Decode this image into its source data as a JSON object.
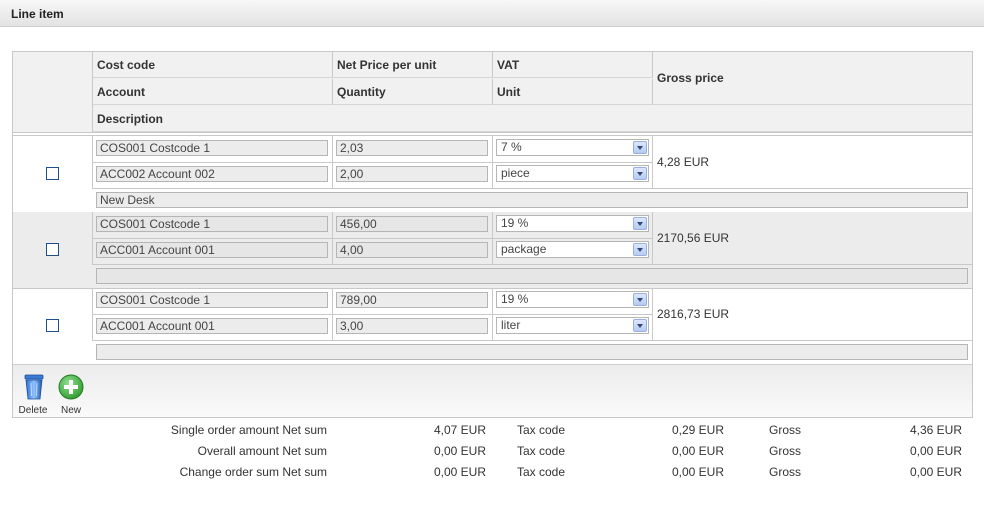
{
  "title": "Line item",
  "headers": {
    "cost_code": "Cost code",
    "net_price": "Net Price per unit",
    "vat": "VAT",
    "account": "Account",
    "quantity": "Quantity",
    "unit": "Unit",
    "gross_price": "Gross price",
    "description": "Description"
  },
  "rows": [
    {
      "cost_code": "COS001 Costcode 1",
      "net_price": "2,03",
      "vat": "7 %",
      "account": "ACC002 Account 002",
      "quantity": "2,00",
      "unit": "piece",
      "gross": "4,28 EUR",
      "description": "New Desk"
    },
    {
      "cost_code": "COS001 Costcode 1",
      "net_price": "456,00",
      "vat": "19 %",
      "account": "ACC001 Account 001",
      "quantity": "4,00",
      "unit": "package",
      "gross": "2170,56 EUR",
      "description": ""
    },
    {
      "cost_code": "COS001 Costcode 1",
      "net_price": "789,00",
      "vat": "19 %",
      "account": "ACC001 Account 001",
      "quantity": "3,00",
      "unit": "liter",
      "gross": "2816,73 EUR",
      "description": ""
    }
  ],
  "toolbar": {
    "delete_label": "Delete",
    "new_label": "New"
  },
  "icons": {
    "delete": "trash-icon",
    "new": "plus-circle-icon"
  },
  "summary": [
    {
      "label": "Single order amount Net sum",
      "net": "4,07 EUR",
      "tax_label": "Tax code",
      "tax": "0,29 EUR",
      "gross_label": "Gross",
      "gross": "4,36 EUR"
    },
    {
      "label": "Overall amount Net sum",
      "net": "0,00 EUR",
      "tax_label": "Tax code",
      "tax": "0,00 EUR",
      "gross_label": "Gross",
      "gross": "0,00 EUR"
    },
    {
      "label": "Change order sum Net sum",
      "net": "0,00 EUR",
      "tax_label": "Tax code",
      "tax": "0,00 EUR",
      "gross_label": "Gross",
      "gross": "0,00 EUR"
    }
  ],
  "colors": {
    "accent": "#1f4f86",
    "header_bg": "#f1f1f1",
    "alt_row": "#ececec",
    "new_icon": "#3aa63a"
  }
}
